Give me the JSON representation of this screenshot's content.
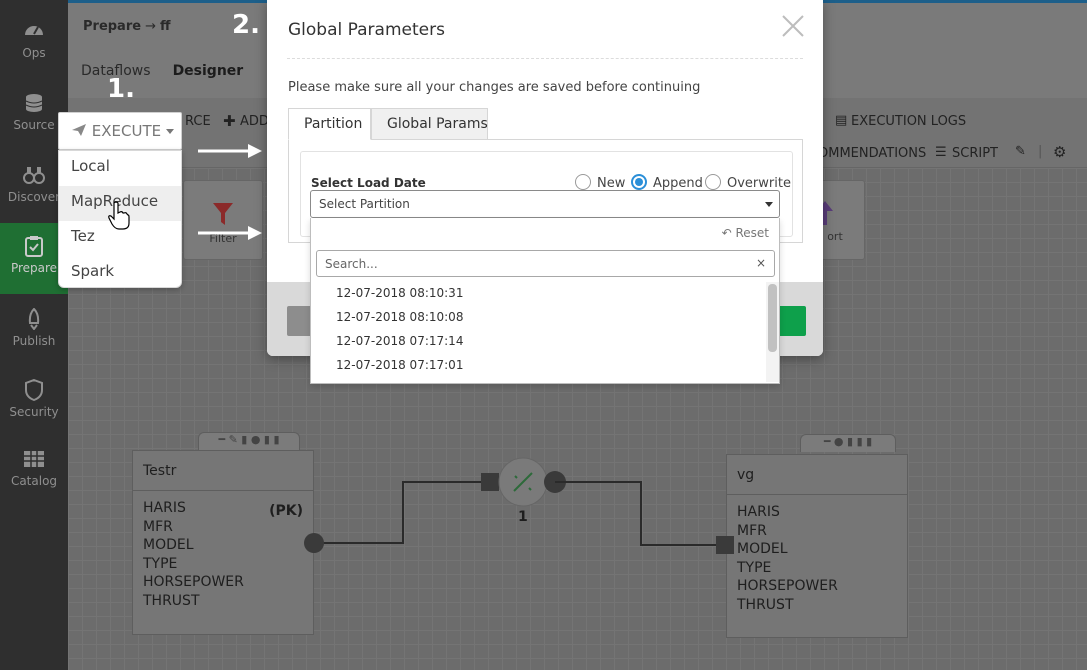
{
  "sidebar": {
    "items": [
      {
        "label": "Ops",
        "icon": "gauge-icon"
      },
      {
        "label": "Source",
        "icon": "database-icon"
      },
      {
        "label": "Discover",
        "icon": "binoculars-icon"
      },
      {
        "label": "Prepare",
        "icon": "clipboard-icon",
        "active": true
      },
      {
        "label": "Publish",
        "icon": "rocket-icon"
      },
      {
        "label": "Security",
        "icon": "shield-icon"
      },
      {
        "label": "Catalog",
        "icon": "grid-icon"
      }
    ]
  },
  "breadcrumb": {
    "root": "Prepare",
    "separator": "→",
    "current": "ff"
  },
  "main_tabs": [
    "Dataflows",
    "Designer"
  ],
  "toolbar": {
    "source_partial": "RCE",
    "add_partial": "ADD",
    "execution_logs": "EXECUTION LOGS",
    "recommendations_partial": "OMMENDATIONS",
    "script": "SCRIPT"
  },
  "palette": {
    "filter": "Filter",
    "export_partial": "ort"
  },
  "steps": {
    "one": "1.",
    "two": "2."
  },
  "execute": {
    "label": "EXECUTE",
    "options": [
      "Local",
      "MapReduce",
      "Tez",
      "Spark"
    ],
    "hovered": "MapReduce"
  },
  "nodes": {
    "left": {
      "title": "Testr",
      "pk": "(PK)",
      "columns": [
        "HARIS",
        "MFR",
        "MODEL",
        "TYPE",
        "HORSEPOWER",
        "THRUST"
      ]
    },
    "join": {
      "label": "1"
    },
    "right": {
      "title": "vg",
      "columns": [
        "HARIS",
        "MFR",
        "MODEL",
        "TYPE",
        "HORSEPOWER",
        "THRUST"
      ]
    }
  },
  "modal": {
    "title": "Global Parameters",
    "note": "Please make sure all your changes are saved before continuing",
    "tabs": [
      "Partition",
      "Global Params"
    ],
    "load_date_label": "Select Load Date",
    "radios": [
      "New",
      "Append",
      "Overwrite"
    ],
    "selected_radio": "Append",
    "select_placeholder": "Select Partition",
    "reset": "Reset",
    "search_placeholder": "Search...",
    "search_clear": "×",
    "options": [
      "12-07-2018 08:10:31",
      "12-07-2018 08:10:08",
      "12-07-2018 07:17:14",
      "12-07-2018 07:17:01"
    ]
  },
  "colors": {
    "accent": "#2b8fd8",
    "prepare_active": "#1f6f33",
    "confirm": "#0ea04b"
  }
}
